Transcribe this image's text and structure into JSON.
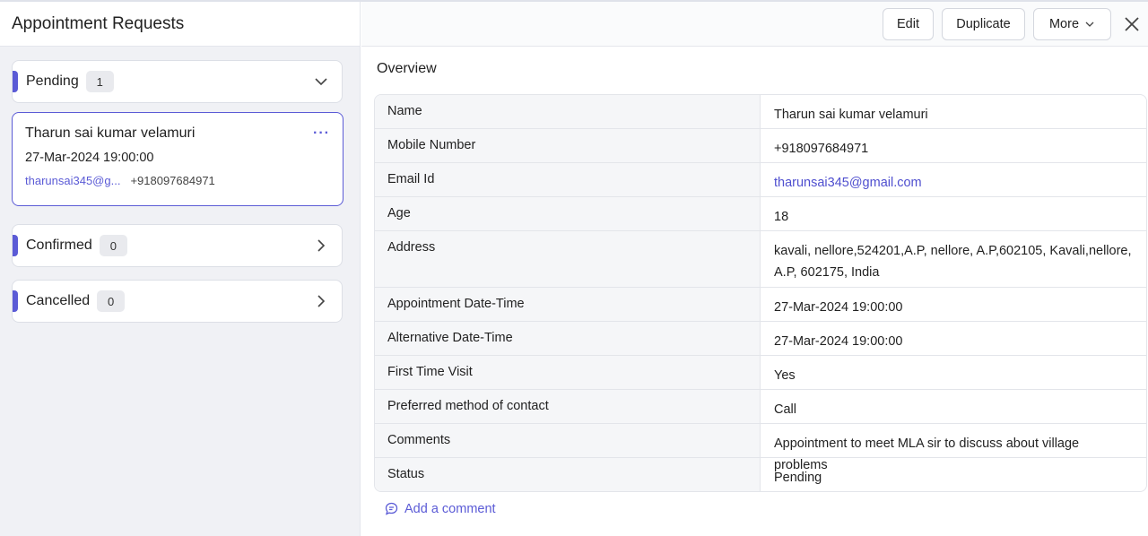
{
  "left": {
    "title": "Appointment Requests",
    "groups": [
      {
        "label": "Pending",
        "count": "1"
      },
      {
        "label": "Confirmed",
        "count": "0"
      },
      {
        "label": "Cancelled",
        "count": "0"
      }
    ],
    "card": {
      "name": "Tharun sai kumar velamuri",
      "more": "···",
      "datetime": "27-Mar-2024 19:00:00",
      "email_short": "tharunsai345@g...",
      "phone": "+918097684971"
    }
  },
  "toolbar": {
    "edit_label": "Edit",
    "duplicate_label": "Duplicate",
    "more_label": "More"
  },
  "overview": {
    "title": "Overview",
    "rows": [
      {
        "key": "Name",
        "value": "Tharun sai kumar velamuri"
      },
      {
        "key": "Mobile Number",
        "value": "+918097684971"
      },
      {
        "key": "Email Id",
        "value": "tharunsai345@gmail.com"
      },
      {
        "key": "Age",
        "value": "18"
      },
      {
        "key": "Address",
        "value": "kavali, nellore,524201,A.P, nellore, A.P,602105, Kavali,nellore, A.P, 602175, India"
      },
      {
        "key": "Appointment Date-Time",
        "value": "27-Mar-2024 19:00:00"
      },
      {
        "key": "Alternative Date-Time",
        "value": "27-Mar-2024 19:00:00"
      },
      {
        "key": "First Time Visit",
        "value": "Yes"
      },
      {
        "key": "Preferred method of contact",
        "value": "Call"
      },
      {
        "key": "Comments",
        "value": "Appointment to meet MLA sir to discuss about village problems"
      },
      {
        "key": "Status",
        "value": "Pending"
      }
    ],
    "add_comment_label": "Add a comment"
  },
  "colors": {
    "accent": "#5b5bd6",
    "panel_bg": "#f0f1f5",
    "border": "#dcdfe6"
  },
  "icons": {
    "group_expanded": "chevron-down-icon",
    "group_collapsed": "chevron-right-icon",
    "close": "close-icon",
    "comment": "comment-icon",
    "card_menu": "more-horizontal-icon"
  }
}
